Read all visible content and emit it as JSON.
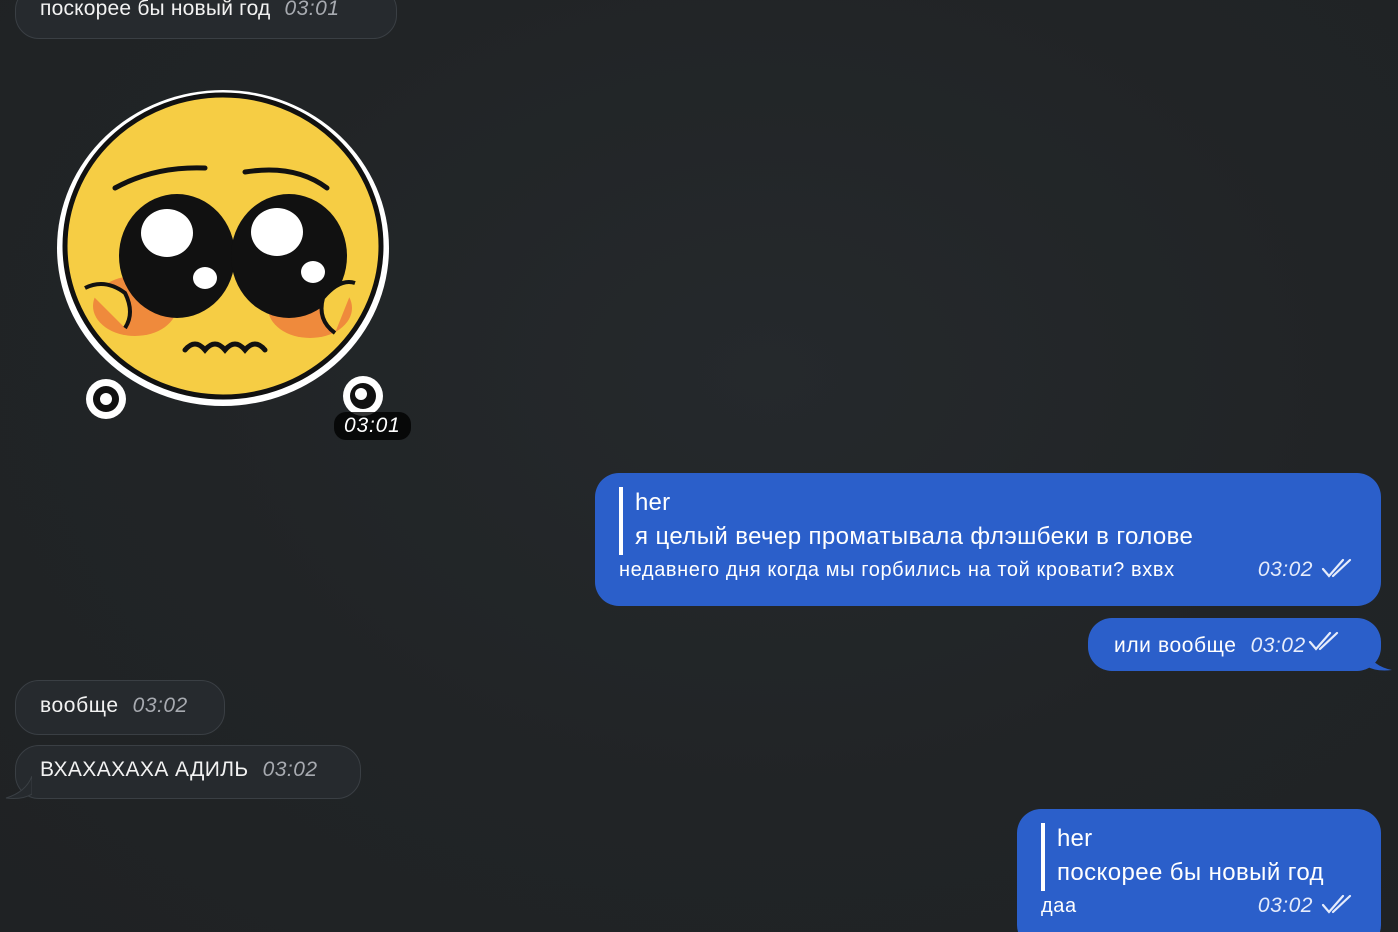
{
  "messages": [
    {
      "id": "m1",
      "side": "in",
      "text": "поскорее бы новый год",
      "time": "03:01"
    },
    {
      "id": "m2",
      "side": "in",
      "type": "sticker",
      "sticker": "pleading-face-sticker",
      "time": "03:01"
    },
    {
      "id": "m3",
      "side": "out",
      "reply_author": "her",
      "reply_text": "я целый вечер проматывала флэшбеки в голове",
      "text": "недавнего дня когда мы горбились на той кровати? вхвх",
      "time": "03:02",
      "status": "read"
    },
    {
      "id": "m4",
      "side": "out",
      "text": "или вообще",
      "time": "03:02",
      "status": "read"
    },
    {
      "id": "m5",
      "side": "in",
      "text": "вообще",
      "time": "03:02"
    },
    {
      "id": "m6",
      "side": "in",
      "text": "ВХАХАХАХА АДИЛЬ",
      "time": "03:02"
    },
    {
      "id": "m7",
      "side": "out",
      "reply_author": "her",
      "reply_text": "поскорее бы новый год",
      "text": "даа",
      "time": "03:02",
      "status": "read"
    }
  ],
  "colors": {
    "background": "#212426",
    "incoming_bubble": "#262a2e",
    "outgoing_bubble": "#2b5fca"
  },
  "icons": {
    "read_status": "double-check-icon",
    "sticker": "pleading-face-sticker"
  }
}
